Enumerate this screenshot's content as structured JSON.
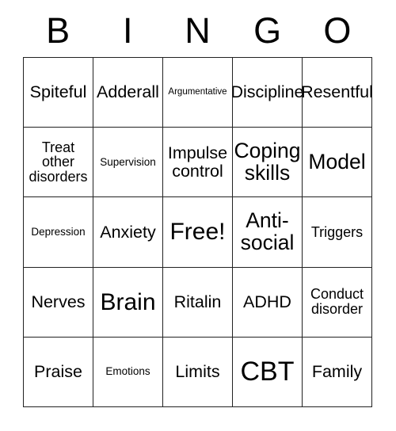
{
  "card": {
    "title": "BINGO Card",
    "header_letters": [
      "B",
      "I",
      "N",
      "G",
      "O"
    ],
    "colors": {
      "border": "#222222",
      "background": "#ffffff",
      "text": "#000000"
    },
    "grid": {
      "rows": 5,
      "columns": 5,
      "free_space_index": 12
    },
    "cells": [
      {
        "text": "Spiteful",
        "size": "lg"
      },
      {
        "text": "Adderall",
        "size": "lg"
      },
      {
        "text": "Argumentative",
        "size": "xs"
      },
      {
        "text": "Discipline",
        "size": "lg"
      },
      {
        "text": "Resentful",
        "size": "lg"
      },
      {
        "text": "Treat\nother\ndisorders",
        "size": "md"
      },
      {
        "text": "Supervision",
        "size": "sm"
      },
      {
        "text": "Impulse\ncontrol",
        "size": "lg"
      },
      {
        "text": "Coping\nskills",
        "size": "xl"
      },
      {
        "text": "Model",
        "size": "xl"
      },
      {
        "text": "Depression",
        "size": "sm"
      },
      {
        "text": "Anxiety",
        "size": "lg"
      },
      {
        "text": "Free!",
        "size": "xxl"
      },
      {
        "text": "Anti-\nsocial",
        "size": "xl"
      },
      {
        "text": "Triggers",
        "size": "md"
      },
      {
        "text": "Nerves",
        "size": "lg"
      },
      {
        "text": "Brain",
        "size": "xxl"
      },
      {
        "text": "Ritalin",
        "size": "lg"
      },
      {
        "text": "ADHD",
        "size": "lg"
      },
      {
        "text": "Conduct\ndisorder",
        "size": "md"
      },
      {
        "text": "Praise",
        "size": "lg"
      },
      {
        "text": "Emotions",
        "size": "sm"
      },
      {
        "text": "Limits",
        "size": "lg"
      },
      {
        "text": "CBT",
        "size": "huge"
      },
      {
        "text": "Family",
        "size": "lg"
      }
    ]
  }
}
